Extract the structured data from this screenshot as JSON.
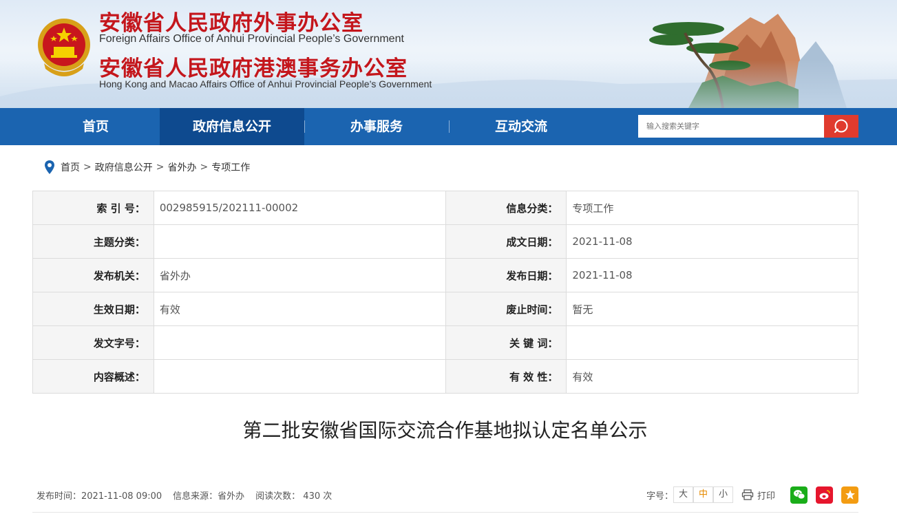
{
  "header": {
    "title_cn": "安徽省人民政府外事办公室",
    "title_en": "Foreign Affairs Office of Anhui Provincial People’s Government",
    "title_cn2": "安徽省人民政府港澳事务办公室",
    "title_en2": "Hong Kong and Macao Affairs Office of Anhui Provincial People’s Government",
    "emblem_icon": "national-emblem-icon"
  },
  "nav": {
    "items": [
      {
        "label": "首页"
      },
      {
        "label": "政府信息公开"
      },
      {
        "label": "办事服务"
      },
      {
        "label": "互动交流"
      }
    ],
    "active_index": 1,
    "search_placeholder": "输入搜索关键字",
    "search_icon": "search-icon"
  },
  "breadcrumb": {
    "icon": "location-pin-icon",
    "items": [
      "首页",
      "政府信息公开",
      "省外办",
      "专项工作"
    ],
    "separator": ">"
  },
  "meta": {
    "rows": [
      {
        "l1": "索 引 号：",
        "v1": "002985915/202111-00002",
        "l2": "信息分类：",
        "v2": "专项工作"
      },
      {
        "l1": "主题分类：",
        "v1": "",
        "l2": "成文日期：",
        "v2": "2021-11-08"
      },
      {
        "l1": "发布机关：",
        "v1": "省外办",
        "l2": "发布日期：",
        "v2": "2021-11-08"
      },
      {
        "l1": "生效日期：",
        "v1": "有效",
        "l2": "废止时间：",
        "v2": "暂无"
      },
      {
        "l1": "发文字号：",
        "v1": "",
        "l2": "关 键 词：",
        "v2": ""
      },
      {
        "l1": "内容概述：",
        "v1": "",
        "l2": "有 效 性：",
        "v2": "有效"
      }
    ]
  },
  "article": {
    "title": "第二批安徽省国际交流合作基地拟认定名单公示",
    "publish_time": "发布时间：2021-11-08 09:00",
    "source": "信息来源：省外办",
    "views": "阅读次数： 430 次"
  },
  "tools": {
    "font_label": "字号：",
    "font_sizes": [
      "大",
      "中",
      "小"
    ],
    "selected_size": "中",
    "print_label": "打印",
    "share_icons": [
      "wechat-icon",
      "weibo-icon",
      "favorite-icon"
    ]
  },
  "colors": {
    "brand_red": "#c4161c",
    "nav_blue": "#1b64b0",
    "nav_active": "#0e4a8f",
    "search_red": "#e03b2e"
  }
}
